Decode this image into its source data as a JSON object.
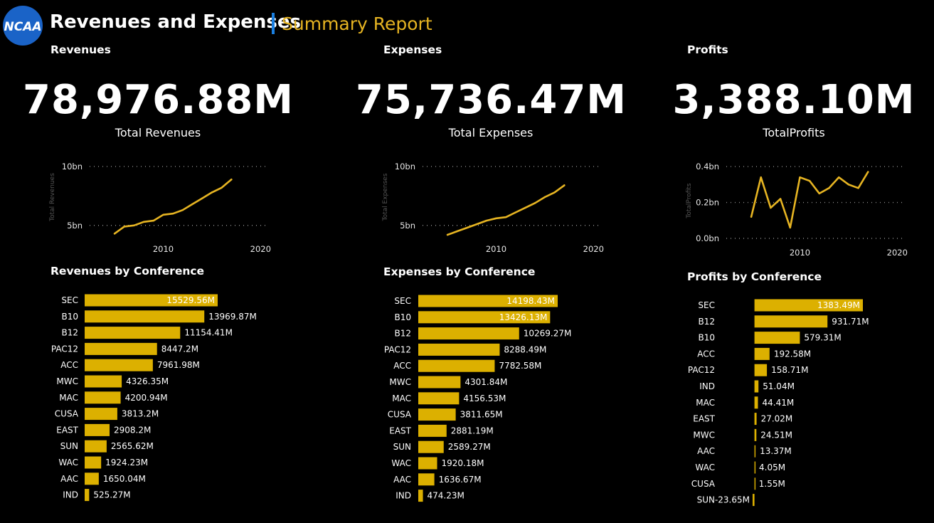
{
  "header": {
    "logo_text": "NCAA",
    "title": "Revenues and Expenses",
    "subtitle": "Summary Report"
  },
  "colors": {
    "accent": "#e6b422",
    "bar": "#dcb000",
    "sep": "#1a7fe0",
    "logo": "#1a63c7"
  },
  "revenues": {
    "title": "Revenues",
    "kpi_value": "78,976.88M",
    "kpi_label": "Total Revenues",
    "by_conf_title": "Revenues by Conference"
  },
  "expenses": {
    "title": "Expenses",
    "kpi_value": "75,736.47M",
    "kpi_label": "Total Expenses",
    "by_conf_title": "Expenses by Conference"
  },
  "profits": {
    "title": "Profits",
    "kpi_value": "3,388.10M",
    "kpi_label": "TotalProfits",
    "by_conf_title": "Profits by Conference"
  },
  "chart_data": [
    {
      "id": "rev-line",
      "type": "line",
      "ylabel": "Total Revenues",
      "yticks": [
        {
          "v": 5,
          "label": "5bn"
        },
        {
          "v": 10,
          "label": "10bn"
        }
      ],
      "xticks": [
        2010,
        2020
      ],
      "xlim": [
        2002,
        2021
      ],
      "ylim": [
        4.2,
        10.6
      ],
      "grid": true,
      "x": [
        2005,
        2006,
        2007,
        2008,
        2009,
        2010,
        2011,
        2012,
        2013,
        2014,
        2015,
        2016,
        2017
      ],
      "y": [
        4.3,
        4.9,
        5.0,
        5.3,
        5.4,
        5.9,
        6.0,
        6.3,
        6.8,
        7.3,
        7.8,
        8.2,
        8.9
      ]
    },
    {
      "id": "exp-line",
      "type": "line",
      "ylabel": "Total Expenses",
      "yticks": [
        {
          "v": 5,
          "label": "5bn"
        },
        {
          "v": 10,
          "label": "10bn"
        }
      ],
      "xticks": [
        2010,
        2020
      ],
      "xlim": [
        2002,
        2021
      ],
      "ylim": [
        4.2,
        10.6
      ],
      "grid": true,
      "x": [
        2005,
        2006,
        2007,
        2008,
        2009,
        2010,
        2011,
        2012,
        2013,
        2014,
        2015,
        2016,
        2017
      ],
      "y": [
        4.2,
        4.5,
        4.8,
        5.1,
        5.4,
        5.6,
        5.7,
        6.1,
        6.5,
        6.9,
        7.4,
        7.8,
        8.4
      ]
    },
    {
      "id": "prof-line",
      "type": "line",
      "ylabel": "TotalProfits",
      "yticks": [
        {
          "v": 0,
          "label": "0.0bn"
        },
        {
          "v": 0.2,
          "label": "0.2bn"
        },
        {
          "v": 0.4,
          "label": "0.4bn"
        }
      ],
      "xticks": [
        2010,
        2020
      ],
      "xlim": [
        2002,
        2021
      ],
      "ylim": [
        0,
        0.42
      ],
      "grid": true,
      "x": [
        2005,
        2006,
        2007,
        2008,
        2009,
        2010,
        2011,
        2012,
        2013,
        2014,
        2015,
        2016,
        2017
      ],
      "y": [
        0.12,
        0.34,
        0.17,
        0.22,
        0.06,
        0.34,
        0.32,
        0.25,
        0.28,
        0.34,
        0.3,
        0.28,
        0.37
      ]
    },
    {
      "id": "rev-bars",
      "type": "bar",
      "categories": [
        "SEC",
        "B10",
        "B12",
        "PAC12",
        "ACC",
        "MWC",
        "MAC",
        "CUSA",
        "EAST",
        "SUN",
        "WAC",
        "AAC",
        "IND"
      ],
      "values": [
        15529.56,
        13969.87,
        11154.41,
        8447.2,
        7961.98,
        4326.35,
        4200.94,
        3813.2,
        2908.2,
        2565.62,
        1924.23,
        1650.04,
        525.27
      ],
      "labels": [
        "15529.56M",
        "13969.87M",
        "11154.41M",
        "8447.2M",
        "7961.98M",
        "4326.35M",
        "4200.94M",
        "3813.2M",
        "2908.2M",
        "2565.62M",
        "1924.23M",
        "1650.04M",
        "525.27M"
      ]
    },
    {
      "id": "exp-bars",
      "type": "bar",
      "categories": [
        "SEC",
        "B10",
        "B12",
        "PAC12",
        "ACC",
        "MWC",
        "MAC",
        "CUSA",
        "EAST",
        "SUN",
        "WAC",
        "AAC",
        "IND"
      ],
      "values": [
        14198.43,
        13426.13,
        10269.27,
        8288.49,
        7782.58,
        4301.84,
        4156.53,
        3811.65,
        2881.19,
        2589.27,
        1920.18,
        1636.67,
        474.23
      ],
      "labels": [
        "14198.43M",
        "13426.13M",
        "10269.27M",
        "8288.49M",
        "7782.58M",
        "4301.84M",
        "4156.53M",
        "3811.65M",
        "2881.19M",
        "2589.27M",
        "1920.18M",
        "1636.67M",
        "474.23M"
      ]
    },
    {
      "id": "prof-bars",
      "type": "bar",
      "categories": [
        "SEC",
        "B12",
        "B10",
        "ACC",
        "PAC12",
        "IND",
        "MAC",
        "EAST",
        "MWC",
        "AAC",
        "WAC",
        "CUSA",
        "SUN"
      ],
      "values": [
        1383.49,
        931.71,
        579.31,
        192.58,
        158.71,
        51.04,
        44.41,
        27.02,
        24.51,
        13.37,
        4.05,
        1.55,
        -23.65
      ],
      "labels": [
        "1383.49M",
        "931.71M",
        "579.31M",
        "192.58M",
        "158.71M",
        "51.04M",
        "44.41M",
        "27.02M",
        "24.51M",
        "13.37M",
        "4.05M",
        "1.55M",
        "-23.65M"
      ]
    }
  ]
}
